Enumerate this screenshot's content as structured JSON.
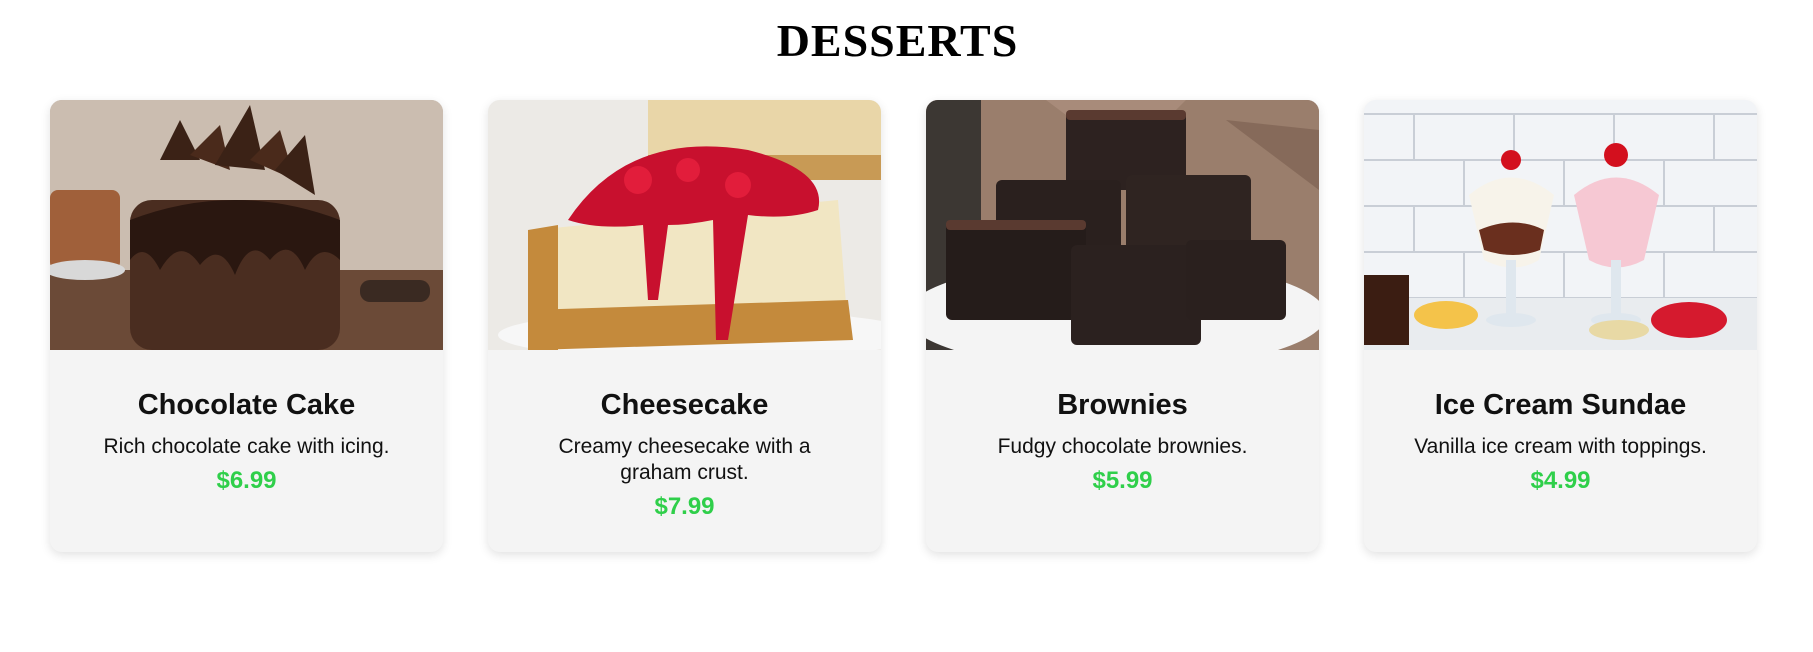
{
  "page": {
    "title": "DESSERTS"
  },
  "desserts": [
    {
      "name": "Chocolate Cake",
      "description": "Rich chocolate cake with icing.",
      "price": "$6.99",
      "image": "chocolate-cake-photo"
    },
    {
      "name": "Cheesecake",
      "description": "Creamy cheesecake with a graham crust.",
      "price": "$7.99",
      "image": "cheesecake-photo"
    },
    {
      "name": "Brownies",
      "description": "Fudgy chocolate brownies.",
      "price": "$5.99",
      "image": "brownies-photo"
    },
    {
      "name": "Ice Cream Sundae",
      "description": "Vanilla ice cream with toppings.",
      "price": "$4.99",
      "image": "ice-cream-sundae-photo"
    }
  ],
  "colors": {
    "price": "#2fcf4a",
    "card_bg": "#f4f4f4"
  }
}
